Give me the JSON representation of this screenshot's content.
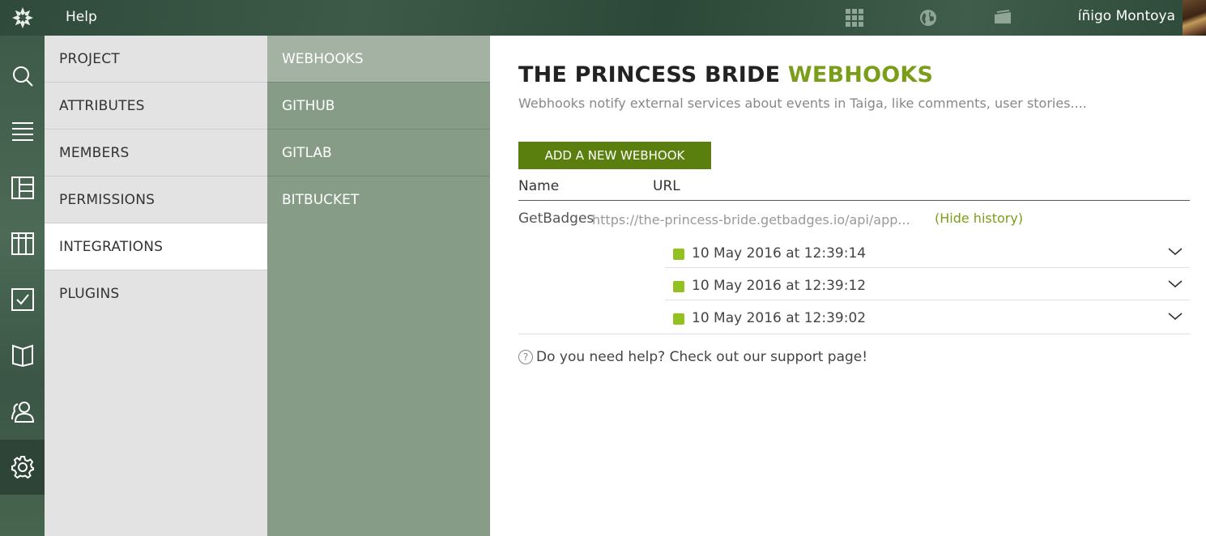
{
  "topbar": {
    "help_label": "Help",
    "username": "íñigo Montoya"
  },
  "admin_menu": {
    "items": [
      {
        "label": "PROJECT"
      },
      {
        "label": "ATTRIBUTES"
      },
      {
        "label": "MEMBERS"
      },
      {
        "label": "PERMISSIONS"
      },
      {
        "label": "INTEGRATIONS"
      },
      {
        "label": "PLUGINS"
      }
    ],
    "active": "INTEGRATIONS"
  },
  "integrations_menu": {
    "items": [
      {
        "label": "WEBHOOKS"
      },
      {
        "label": "GITHUB"
      },
      {
        "label": "GITLAB"
      },
      {
        "label": "BITBUCKET"
      }
    ],
    "active": "WEBHOOKS"
  },
  "main": {
    "title_project": "THE PRINCESS BRIDE",
    "title_section": "WEBHOOKS",
    "subtitle": "Webhooks notify external services about events in Taiga, like comments, user stories....",
    "add_button_label": "ADD A NEW WEBHOOK",
    "table": {
      "headers": {
        "name": "Name",
        "url": "URL"
      },
      "webhook": {
        "name": "GetBadges",
        "url": "https://the-princess-bride.getbadges.io/api/app...",
        "toggle_label": "(Hide history)",
        "history": [
          {
            "date": "10 May 2016 at 12:39:14",
            "status_color": "#93c220"
          },
          {
            "date": "10 May 2016 at 12:39:12",
            "status_color": "#93c220"
          },
          {
            "date": "10 May 2016 at 12:39:02",
            "status_color": "#93c220"
          }
        ]
      }
    },
    "help_text": "Do you need help? Check out our support page!"
  },
  "colors": {
    "accent": "#7a9e1a",
    "button": "#5b7f0e",
    "sub_menu_bg": "#869c86",
    "admin_menu_bg": "#e3e3e3"
  },
  "icons": {
    "topbar": [
      "taiga-logo-icon",
      "apps-grid-icon",
      "globe-icon",
      "projects-icon"
    ],
    "rail": [
      "search-icon",
      "backlog-icon",
      "kanban-icon",
      "taskboard-icon",
      "issues-icon",
      "wiki-icon",
      "team-icon",
      "settings-icon"
    ]
  }
}
